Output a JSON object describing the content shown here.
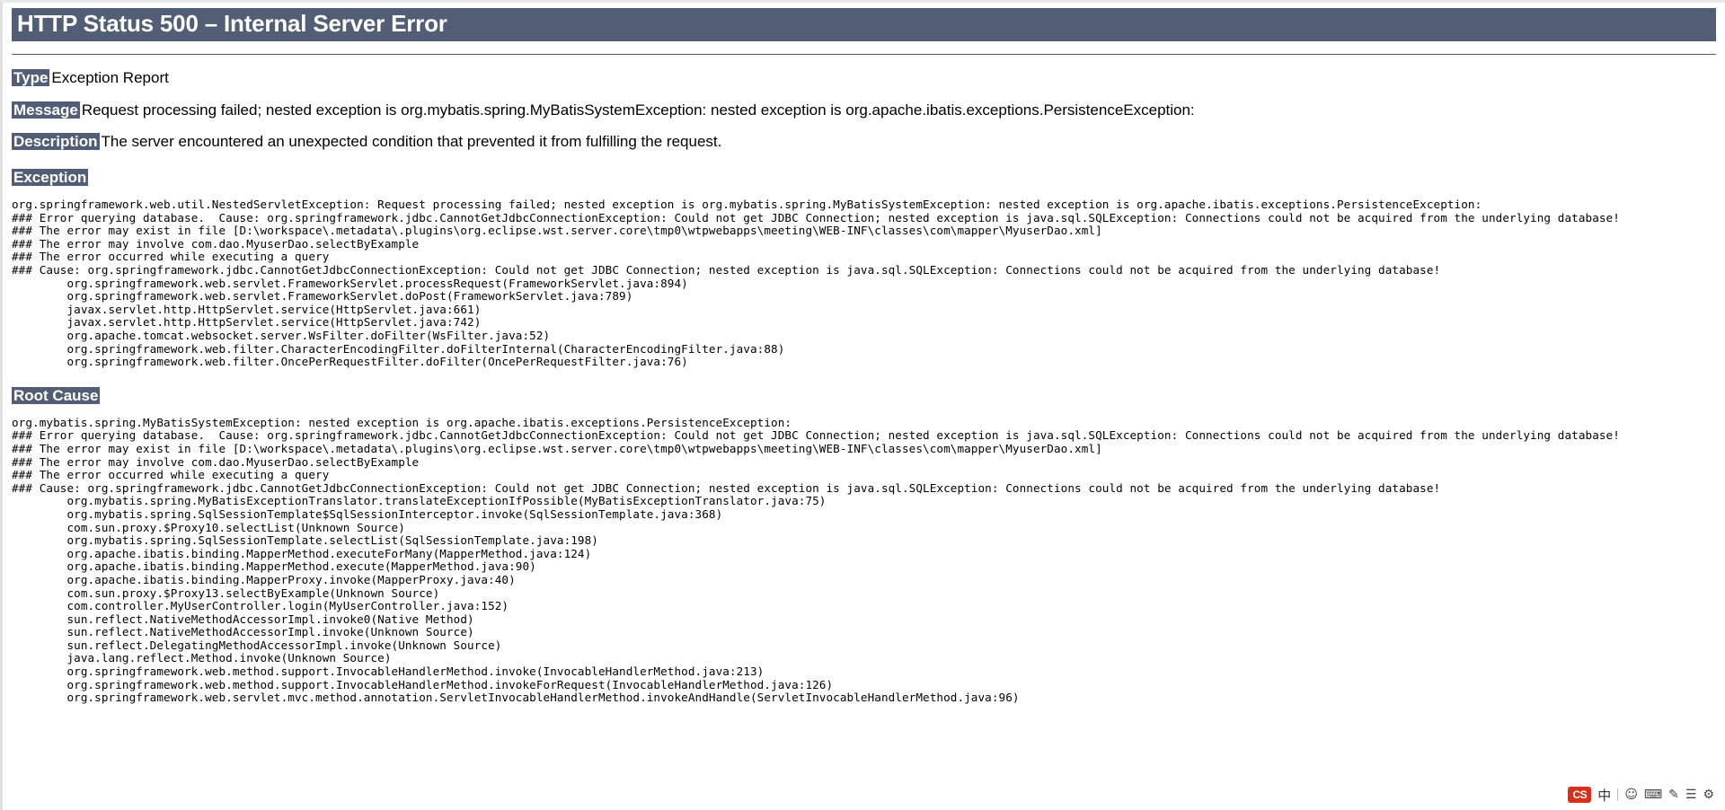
{
  "page": {
    "title": "HTTP Status 500 – Internal Server Error"
  },
  "fields": {
    "type_label": "Type",
    "type_value": "Exception Report",
    "message_label": "Message",
    "message_value": "Request processing failed; nested exception is org.mybatis.spring.MyBatisSystemException: nested exception is org.apache.ibatis.exceptions.PersistenceException:",
    "description_label": "Description",
    "description_value": "The server encountered an unexpected condition that prevented it from fulfilling the request."
  },
  "exception": {
    "heading": "Exception",
    "trace": "org.springframework.web.util.NestedServletException: Request processing failed; nested exception is org.mybatis.spring.MyBatisSystemException: nested exception is org.apache.ibatis.exceptions.PersistenceException:\n### Error querying database.  Cause: org.springframework.jdbc.CannotGetJdbcConnectionException: Could not get JDBC Connection; nested exception is java.sql.SQLException: Connections could not be acquired from the underlying database!\n### The error may exist in file [D:\\workspace\\.metadata\\.plugins\\org.eclipse.wst.server.core\\tmp0\\wtpwebapps\\meeting\\WEB-INF\\classes\\com\\mapper\\MyuserDao.xml]\n### The error may involve com.dao.MyuserDao.selectByExample\n### The error occurred while executing a query\n### Cause: org.springframework.jdbc.CannotGetJdbcConnectionException: Could not get JDBC Connection; nested exception is java.sql.SQLException: Connections could not be acquired from the underlying database!\n        org.springframework.web.servlet.FrameworkServlet.processRequest(FrameworkServlet.java:894)\n        org.springframework.web.servlet.FrameworkServlet.doPost(FrameworkServlet.java:789)\n        javax.servlet.http.HttpServlet.service(HttpServlet.java:661)\n        javax.servlet.http.HttpServlet.service(HttpServlet.java:742)\n        org.apache.tomcat.websocket.server.WsFilter.doFilter(WsFilter.java:52)\n        org.springframework.web.filter.CharacterEncodingFilter.doFilterInternal(CharacterEncodingFilter.java:88)\n        org.springframework.web.filter.OncePerRequestFilter.doFilter(OncePerRequestFilter.java:76)"
  },
  "root_cause": {
    "heading": "Root Cause",
    "trace": "org.mybatis.spring.MyBatisSystemException: nested exception is org.apache.ibatis.exceptions.PersistenceException:\n### Error querying database.  Cause: org.springframework.jdbc.CannotGetJdbcConnectionException: Could not get JDBC Connection; nested exception is java.sql.SQLException: Connections could not be acquired from the underlying database!\n### The error may exist in file [D:\\workspace\\.metadata\\.plugins\\org.eclipse.wst.server.core\\tmp0\\wtpwebapps\\meeting\\WEB-INF\\classes\\com\\mapper\\MyuserDao.xml]\n### The error may involve com.dao.MyuserDao.selectByExample\n### The error occurred while executing a query\n### Cause: org.springframework.jdbc.CannotGetJdbcConnectionException: Could not get JDBC Connection; nested exception is java.sql.SQLException: Connections could not be acquired from the underlying database!\n        org.mybatis.spring.MyBatisExceptionTranslator.translateExceptionIfPossible(MyBatisExceptionTranslator.java:75)\n        org.mybatis.spring.SqlSessionTemplate$SqlSessionInterceptor.invoke(SqlSessionTemplate.java:368)\n        com.sun.proxy.$Proxy10.selectList(Unknown Source)\n        org.mybatis.spring.SqlSessionTemplate.selectList(SqlSessionTemplate.java:198)\n        org.apache.ibatis.binding.MapperMethod.executeForMany(MapperMethod.java:124)\n        org.apache.ibatis.binding.MapperMethod.execute(MapperMethod.java:90)\n        org.apache.ibatis.binding.MapperProxy.invoke(MapperProxy.java:40)\n        com.sun.proxy.$Proxy13.selectByExample(Unknown Source)\n        com.controller.MyUserController.login(MyUserController.java:152)\n        sun.reflect.NativeMethodAccessorImpl.invoke0(Native Method)\n        sun.reflect.NativeMethodAccessorImpl.invoke(Unknown Source)\n        sun.reflect.DelegatingMethodAccessorImpl.invoke(Unknown Source)\n        java.lang.reflect.Method.invoke(Unknown Source)\n        org.springframework.web.method.support.InvocableHandlerMethod.invoke(InvocableHandlerMethod.java:213)\n        org.springframework.web.method.support.InvocableHandlerMethod.invokeForRequest(InvocableHandlerMethod.java:126)\n        org.springframework.web.servlet.mvc.method.annotation.ServletInvocableHandlerMethod.invokeAndHandle(ServletInvocableHandlerMethod.java:96)"
  },
  "ime_toolbar": {
    "logo": "CS",
    "language": "中",
    "icons": [
      "smiley-icon",
      "keyboard-icon",
      "toolbox-icon",
      "settings-icon"
    ],
    "icon_glyphs": [
      "☺",
      "⌨",
      "✎",
      "☰",
      "⚙"
    ]
  },
  "colors": {
    "banner": "#525D76",
    "label": "#525D76",
    "background": "#ffffff",
    "logo_red": "#d81e06"
  }
}
